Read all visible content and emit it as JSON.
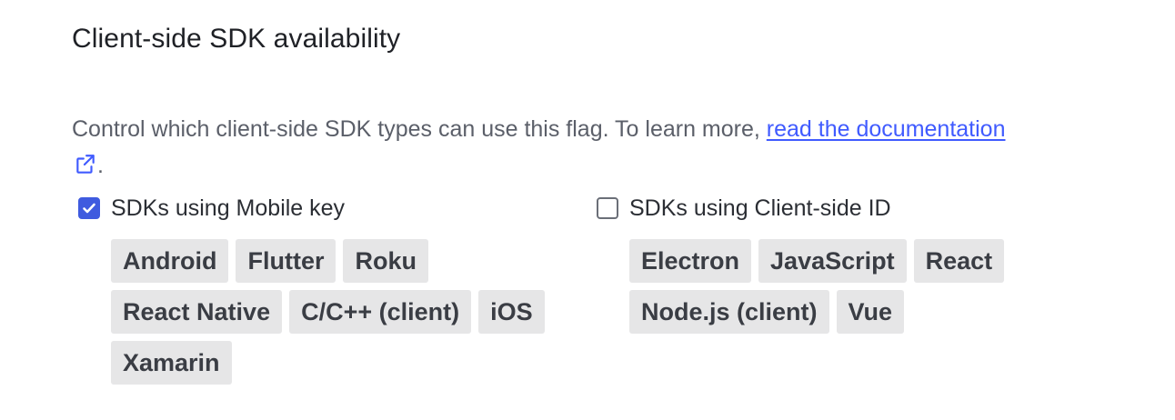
{
  "section": {
    "title": "Client-side SDK availability",
    "description_prefix": "Control which client-side SDK types can use this flag. To learn more, ",
    "doc_link_label": "read the documentation",
    "description_suffix": "."
  },
  "mobile_group": {
    "label": "SDKs using Mobile key",
    "checked": true,
    "sdks": [
      "Android",
      "Flutter",
      "Roku",
      "React Native",
      "C/C++ (client)",
      "iOS",
      "Xamarin"
    ]
  },
  "client_group": {
    "label": "SDKs using Client-side ID",
    "checked": false,
    "sdks": [
      "Electron",
      "JavaScript",
      "React",
      "Node.js (client)",
      "Vue"
    ]
  },
  "colors": {
    "accent": "#405bff",
    "checkbox_checked": "#3f5bdf",
    "chip_bg": "#e6e6e7"
  },
  "icons": {
    "doc_link": "external-link-icon",
    "checked": "checkmark-icon"
  }
}
